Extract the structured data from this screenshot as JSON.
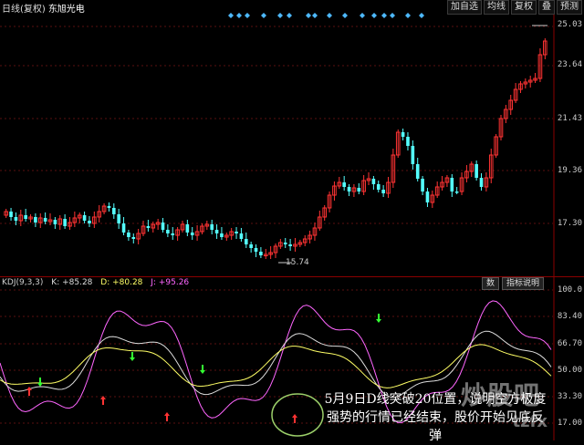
{
  "header": {
    "period_label": "日线(复权)",
    "stock_name": "东旭光电"
  },
  "toolbar": [
    "加自选",
    "均线",
    "复权",
    "叠",
    "预测"
  ],
  "price_axis": [
    "25.03",
    "23.64",
    "21.43",
    "19.36",
    "17.30"
  ],
  "price_marks": {
    "high": "25.03",
    "low": "15.74"
  },
  "kdj": {
    "name": "KDJ(9,3,3)",
    "k": "K: +85.28",
    "d": "D: +80.28",
    "j": "J: +95.26",
    "axis": [
      "100.0",
      "83.40",
      "66.70",
      "50.00",
      "33.30",
      "17.00"
    ],
    "btn_formula": "数",
    "btn_help": "指标说明"
  },
  "colors": {
    "up": "#ff3333",
    "down": "#54ffff",
    "k_line": "#dddddd",
    "d_line": "#ffff66",
    "j_line": "#ff66ff"
  },
  "annotation": "5月9日D线突破20位置，说明空方极度强势的行情已经结束，股价开始见底反弹",
  "watermark": "炒股吧",
  "watermark2": "tzfx"
}
